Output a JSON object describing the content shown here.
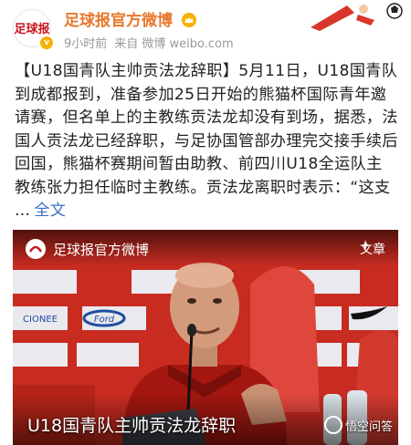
{
  "header": {
    "account_name": "足球报官方微博",
    "time_ago": "9小时前",
    "source_prefix": "来自 微博 weibo.com",
    "avatar_text": "足球报"
  },
  "post": {
    "text": "【U18国青队主帅贡法龙辞职】5月11日，U18国青队到成都报到，准备参加25日开始的熊猫杯国际青年邀请赛，但名单上的主教练贡法龙却没有到场，据悉，法国人贡法龙已经辞职，与足协国管部办理完交接手续后回国，熊猫杯赛期间暂由助教、前四川U18全运队主教练张力担任临时主教练。贡法龙离职时表示：“这支 ...",
    "full_text_label": "全文"
  },
  "media": {
    "account_name": "足球报官方微博",
    "article_label": "文章",
    "caption": "U18国青队主帅贡法龙辞职",
    "watermark": "悟空问答",
    "sponsor_labels": [
      "CIONEE",
      "Ford"
    ]
  },
  "colors": {
    "brand_orange": "#e8772e",
    "link_blue": "#3b70c6",
    "backdrop_red": "#c82b20"
  }
}
